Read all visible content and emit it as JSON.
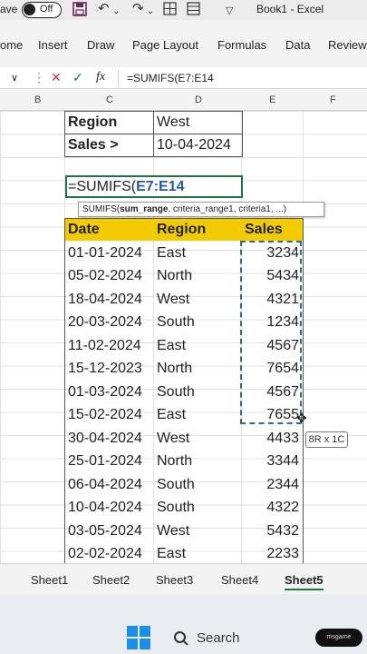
{
  "titlebar": {
    "autosave_label": "ave",
    "toggle_state": "Off",
    "title": "Book1  -  Excel"
  },
  "ribbon": {
    "tabs": [
      "ome",
      "Insert",
      "Draw",
      "Page Layout",
      "Formulas",
      "Data",
      "Review"
    ]
  },
  "formula_bar": {
    "fx_label": "fx",
    "content": "=SUMIFS(E7:E14"
  },
  "columns": [
    "B",
    "C",
    "D",
    "E",
    "F"
  ],
  "criteria": {
    "region_label": "Region",
    "region_value": "West",
    "sales_label": "Sales >",
    "sales_value": "10-04-2024"
  },
  "active_cell": {
    "prefix": "=SUMIFS(",
    "reference": "E7:E14"
  },
  "tooltip": {
    "func": "SUMIFS(",
    "arg_bold": "sum_range",
    "args_rest": ", criteria_range1, criteria1, ...)"
  },
  "table": {
    "headers": [
      "Date",
      "Region",
      "Sales"
    ],
    "rows": [
      [
        "01-01-2024",
        "East",
        "3234"
      ],
      [
        "05-02-2024",
        "North",
        "5434"
      ],
      [
        "18-04-2024",
        "West",
        "4321"
      ],
      [
        "20-03-2024",
        "South",
        "1234"
      ],
      [
        "11-02-2024",
        "East",
        "4567"
      ],
      [
        "15-12-2023",
        "North",
        "7654"
      ],
      [
        "01-03-2024",
        "South",
        "4567"
      ],
      [
        "15-02-2024",
        "East",
        "7655"
      ],
      [
        "30-04-2024",
        "West",
        "4433"
      ],
      [
        "25-01-2024",
        "North",
        "3344"
      ],
      [
        "06-04-2024",
        "South",
        "2344"
      ],
      [
        "10-04-2024",
        "South",
        "4322"
      ],
      [
        "03-05-2024",
        "West",
        "5432"
      ],
      [
        "02-02-2024",
        "East",
        "2233"
      ]
    ]
  },
  "selection_size": "8R x 1C",
  "sheets": [
    "Sheet1",
    "Sheet2",
    "Sheet3",
    "Sheet4",
    "Sheet5"
  ],
  "active_sheet_index": 4,
  "taskbar": {
    "search_label": "Search",
    "pill_label": "msgame"
  },
  "colors": {
    "header_fill": "#f2cc00",
    "excel_green": "#217346",
    "reference_blue": "#2656a6"
  }
}
